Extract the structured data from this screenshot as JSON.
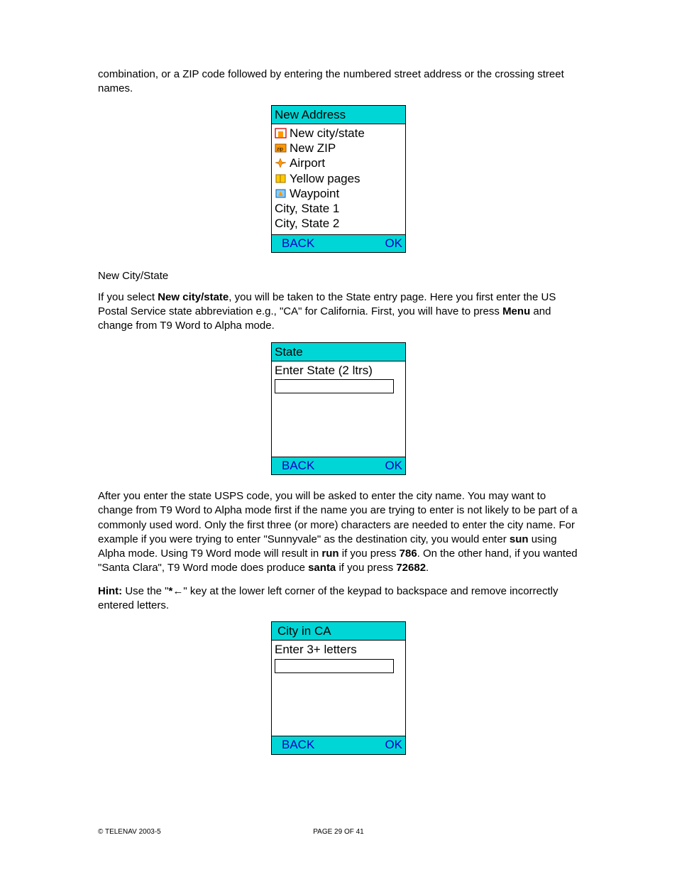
{
  "intro_paragraph": "combination, or a ZIP code followed by entering the numbered street address or the crossing street names.",
  "screen1": {
    "title": "New Address",
    "items": [
      "New city/state",
      "New ZIP",
      "Airport",
      "Yellow pages",
      "Waypoint"
    ],
    "plain_rows": [
      "City, State 1",
      "City, State 2"
    ],
    "btn_left": "BACK",
    "btn_right": "OK"
  },
  "heading_new_city_state": "New City/State",
  "para2_pre": "If you select ",
  "para2_bold1": "New city/state",
  "para2_mid": ", you will be taken to the State entry page. Here you first enter the US Postal Service state abbreviation e.g., \"CA\" for California.   First, you will have to press ",
  "para2_bold2": "Menu",
  "para2_post": " and change from T9 Word to Alpha mode.",
  "screen2": {
    "title": "State",
    "prompt": "Enter State (2 ltrs)",
    "btn_left": "BACK",
    "btn_right": "OK"
  },
  "para3_a": "After you enter the state USPS code, you will be asked to enter the city name.  You may want to change from T9 Word to Alpha mode first if the name you are trying to enter is not likely to be part of a commonly used word.  Only the first three (or more) characters are needed to enter the city name. For example if you were trying to enter \"Sunnyvale\" as the destination city, you would enter ",
  "para3_bold_sun": "sun",
  "para3_b": " using Alpha mode.  Using T9 Word mode will result in ",
  "para3_bold_run": "run",
  "para3_c": " if you press ",
  "para3_bold_786": "786",
  "para3_d": ".  On the other hand, if you wanted \"Santa Clara\", T9 Word mode does produce ",
  "para3_bold_santa": "santa",
  "para3_e": " if you press ",
  "para3_bold_72682": "72682",
  "para3_f": ".",
  "hint_label": "Hint:",
  "hint_a": "  Use the \"",
  "hint_bold_star": "*",
  "hint_arrow": "←",
  "hint_b": "\" key at the lower left corner of the keypad to backspace and remove incorrectly entered letters.",
  "screen3": {
    "title": "City in CA",
    "prompt": "Enter 3+ letters",
    "btn_left": "BACK",
    "btn_right": "OK"
  },
  "footer": {
    "left": "© TELENAV 2003-5",
    "center": "PAGE 29 OF 41"
  }
}
